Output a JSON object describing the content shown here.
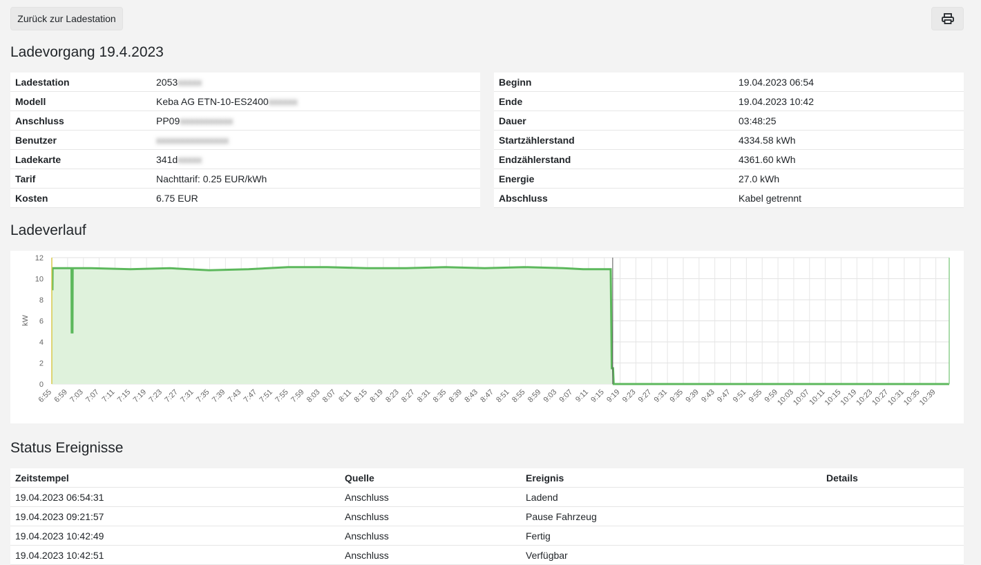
{
  "toolbar": {
    "back_label": "Zurück zur Ladestation",
    "print_icon": "printer-icon"
  },
  "title": "Ladevorgang 19.4.2023",
  "info_left": [
    {
      "key": "Ladestation",
      "value": "2053",
      "blurred": "xxxxx"
    },
    {
      "key": "Modell",
      "value": "Keba AG ETN-10-ES2400",
      "blurred": "xxxxxx"
    },
    {
      "key": "Anschluss",
      "value": "PP09",
      "blurred": "xxxxxxxxxxx"
    },
    {
      "key": "Benutzer",
      "value": "",
      "blurred": "xxxxxxxxxxxxxxx"
    },
    {
      "key": "Ladekarte",
      "value": "341d",
      "blurred": "xxxxx"
    },
    {
      "key": "Tarif",
      "value": "Nachttarif: 0.25 EUR/kWh",
      "blurred": ""
    },
    {
      "key": "Kosten",
      "value": "6.75 EUR",
      "blurred": ""
    }
  ],
  "info_right": [
    {
      "key": "Beginn",
      "value": "19.04.2023 06:54"
    },
    {
      "key": "Ende",
      "value": "19.04.2023 10:42"
    },
    {
      "key": "Dauer",
      "value": "03:48:25"
    },
    {
      "key": "Startzählerstand",
      "value": "4334.58 kWh"
    },
    {
      "key": "Endzählerstand",
      "value": "4361.60 kWh"
    },
    {
      "key": "Energie",
      "value": "27.0 kWh"
    },
    {
      "key": "Abschluss",
      "value": "Kabel getrennt"
    }
  ],
  "verlauf_title": "Ladeverlauf",
  "chart_data": {
    "type": "area",
    "ylabel": "kW",
    "ylim": [
      0,
      12
    ],
    "yticks": [
      0,
      2,
      4,
      6,
      8,
      10,
      12
    ],
    "xlabels": [
      "6:55",
      "6:59",
      "7:03",
      "7:07",
      "7:11",
      "7:15",
      "7:19",
      "7:23",
      "7:27",
      "7:31",
      "7:35",
      "7:39",
      "7:43",
      "7:47",
      "7:51",
      "7:55",
      "7:59",
      "8:03",
      "8:07",
      "8:11",
      "8:15",
      "8:19",
      "8:23",
      "8:27",
      "8:31",
      "8:35",
      "8:39",
      "8:43",
      "8:47",
      "8:51",
      "8:55",
      "8:59",
      "9:03",
      "9:07",
      "9:11",
      "9:15",
      "9:19",
      "9:23",
      "9:27",
      "9:31",
      "9:35",
      "9:39",
      "9:43",
      "9:47",
      "9:51",
      "9:55",
      "9:59",
      "10:03",
      "10:07",
      "10:11",
      "10:15",
      "10:19",
      "10:23",
      "10:27",
      "10:31",
      "10:35",
      "10:39"
    ],
    "series_color": "#5cb85c",
    "fill_color": "#dff2dc",
    "points": [
      [
        0,
        9.0
      ],
      [
        0.3,
        9.0
      ],
      [
        0.4,
        11.0
      ],
      [
        10,
        11.0
      ],
      [
        10.1,
        4.9
      ],
      [
        10.5,
        4.9
      ],
      [
        10.6,
        11.0
      ],
      [
        20,
        11.0
      ],
      [
        40,
        10.9
      ],
      [
        60,
        11.0
      ],
      [
        80,
        10.8
      ],
      [
        100,
        10.9
      ],
      [
        120,
        11.1
      ],
      [
        140,
        11.1
      ],
      [
        160,
        11.0
      ],
      [
        180,
        11.0
      ],
      [
        200,
        11.1
      ],
      [
        220,
        11.0
      ],
      [
        240,
        11.1
      ],
      [
        260,
        11.0
      ],
      [
        270,
        10.9
      ],
      [
        284,
        10.9
      ],
      [
        284.5,
        1.5
      ],
      [
        285.2,
        1.5
      ],
      [
        285.5,
        0.0
      ],
      [
        300,
        0.0
      ],
      [
        456,
        0.0
      ]
    ],
    "x_total_minutes": 456
  },
  "events_title": "Status Ereignisse",
  "events": {
    "headers": [
      "Zeitstempel",
      "Quelle",
      "Ereignis",
      "Details"
    ],
    "rows": [
      [
        "19.04.2023 06:54:31",
        "Anschluss",
        "Ladend",
        ""
      ],
      [
        "19.04.2023 09:21:57",
        "Anschluss",
        "Pause Fahrzeug",
        ""
      ],
      [
        "19.04.2023 10:42:49",
        "Anschluss",
        "Fertig",
        ""
      ],
      [
        "19.04.2023 10:42:51",
        "Anschluss",
        "Verfügbar",
        ""
      ]
    ]
  }
}
